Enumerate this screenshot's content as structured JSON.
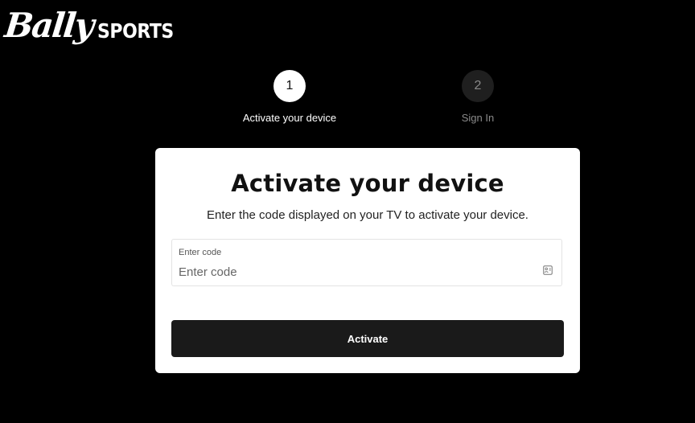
{
  "logo": {
    "script_text": "Bally",
    "sports_text": "SPORTS"
  },
  "stepper": {
    "steps": [
      {
        "number": "1",
        "label": "Activate your device",
        "state": "active"
      },
      {
        "number": "2",
        "label": "Sign In",
        "state": "inactive"
      }
    ]
  },
  "card": {
    "title": "Activate your device",
    "subtitle": "Enter the code displayed on your TV to activate your device.",
    "code_field": {
      "label": "Enter code",
      "placeholder": "Enter code",
      "value": "",
      "icon": "autofill-card-icon"
    },
    "activate_button_label": "Activate"
  },
  "colors": {
    "background": "#000000",
    "card": "#ffffff",
    "button": "#1a1a1a",
    "step_inactive": "#1f1f1f"
  }
}
